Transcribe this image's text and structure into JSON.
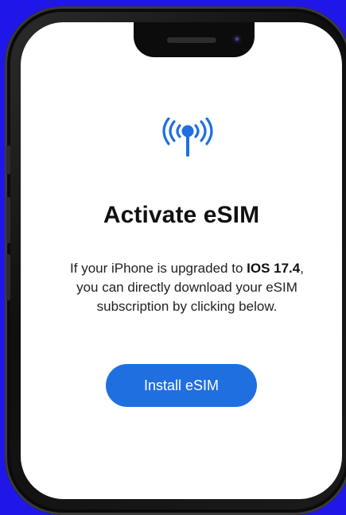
{
  "screen": {
    "title": "Activate eSIM",
    "description": {
      "part1": "If your iPhone is upgraded to ",
      "bold1": "IOS 17.4",
      "part2": ", you can directly download your eSIM subscription by clicking below."
    },
    "button_label": "Install eSIM",
    "icon": "antenna-broadcast-icon"
  },
  "colors": {
    "background": "#1f17e8",
    "accent": "#1f6fe0",
    "text": "#111111"
  }
}
